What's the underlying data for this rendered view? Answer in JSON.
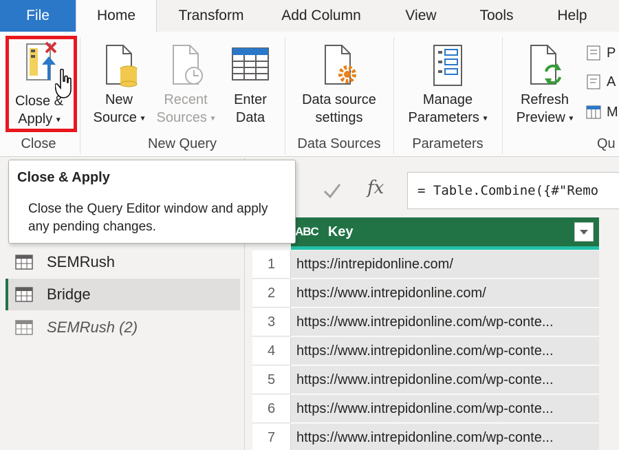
{
  "tabs": {
    "file": "File",
    "home": "Home",
    "transform": "Transform",
    "add_column": "Add Column",
    "view": "View",
    "tools": "Tools",
    "help": "Help"
  },
  "ribbon": {
    "close_apply": {
      "line1": "Close &",
      "line2": "Apply",
      "caret": "▾"
    },
    "new_source": {
      "line1": "New",
      "line2": "Source",
      "caret": "▾"
    },
    "recent_sources": {
      "line1": "Recent",
      "line2": "Sources",
      "caret": "▾"
    },
    "enter_data": {
      "line1": "Enter",
      "line2": "Data"
    },
    "data_source_settings": {
      "line1": "Data source",
      "line2": "settings"
    },
    "manage_parameters": {
      "line1": "Manage",
      "line2": "Parameters",
      "caret": "▾"
    },
    "refresh_preview": {
      "line1": "Refresh",
      "line2": "Preview",
      "caret": "▾"
    },
    "small_items": [
      "P",
      "A",
      "M"
    ],
    "groups": {
      "close": "Close",
      "new_query": "New Query",
      "data_sources": "Data Sources",
      "parameters": "Parameters",
      "query": "Qu"
    }
  },
  "tooltip": {
    "title": "Close & Apply",
    "body": "Close the Query Editor window and apply any pending changes."
  },
  "queries": [
    {
      "name": "SEMRush",
      "selected": false,
      "italic": false
    },
    {
      "name": "Bridge",
      "selected": true,
      "italic": false
    },
    {
      "name": "SEMRush (2)",
      "selected": false,
      "italic": true
    }
  ],
  "formula_bar": {
    "fx": "fx",
    "formula": "= Table.Combine({#\"Remo"
  },
  "grid": {
    "column_type_icon": "ABC",
    "column_header": "Key",
    "rows": [
      {
        "num": "1",
        "value": "https://intrepidonline.com/"
      },
      {
        "num": "2",
        "value": "https://www.intrepidonline.com/"
      },
      {
        "num": "3",
        "value": "https://www.intrepidonline.com/wp-conte..."
      },
      {
        "num": "4",
        "value": "https://www.intrepidonline.com/wp-conte..."
      },
      {
        "num": "5",
        "value": "https://www.intrepidonline.com/wp-conte..."
      },
      {
        "num": "6",
        "value": "https://www.intrepidonline.com/wp-conte..."
      },
      {
        "num": "7",
        "value": "https://www.intrepidonline.com/wp-conte..."
      }
    ]
  },
  "colors": {
    "file_tab": "#2b78c9",
    "column_header": "#217346",
    "highlight_box": "#e8161e",
    "header_accent": "#22c2a8"
  }
}
